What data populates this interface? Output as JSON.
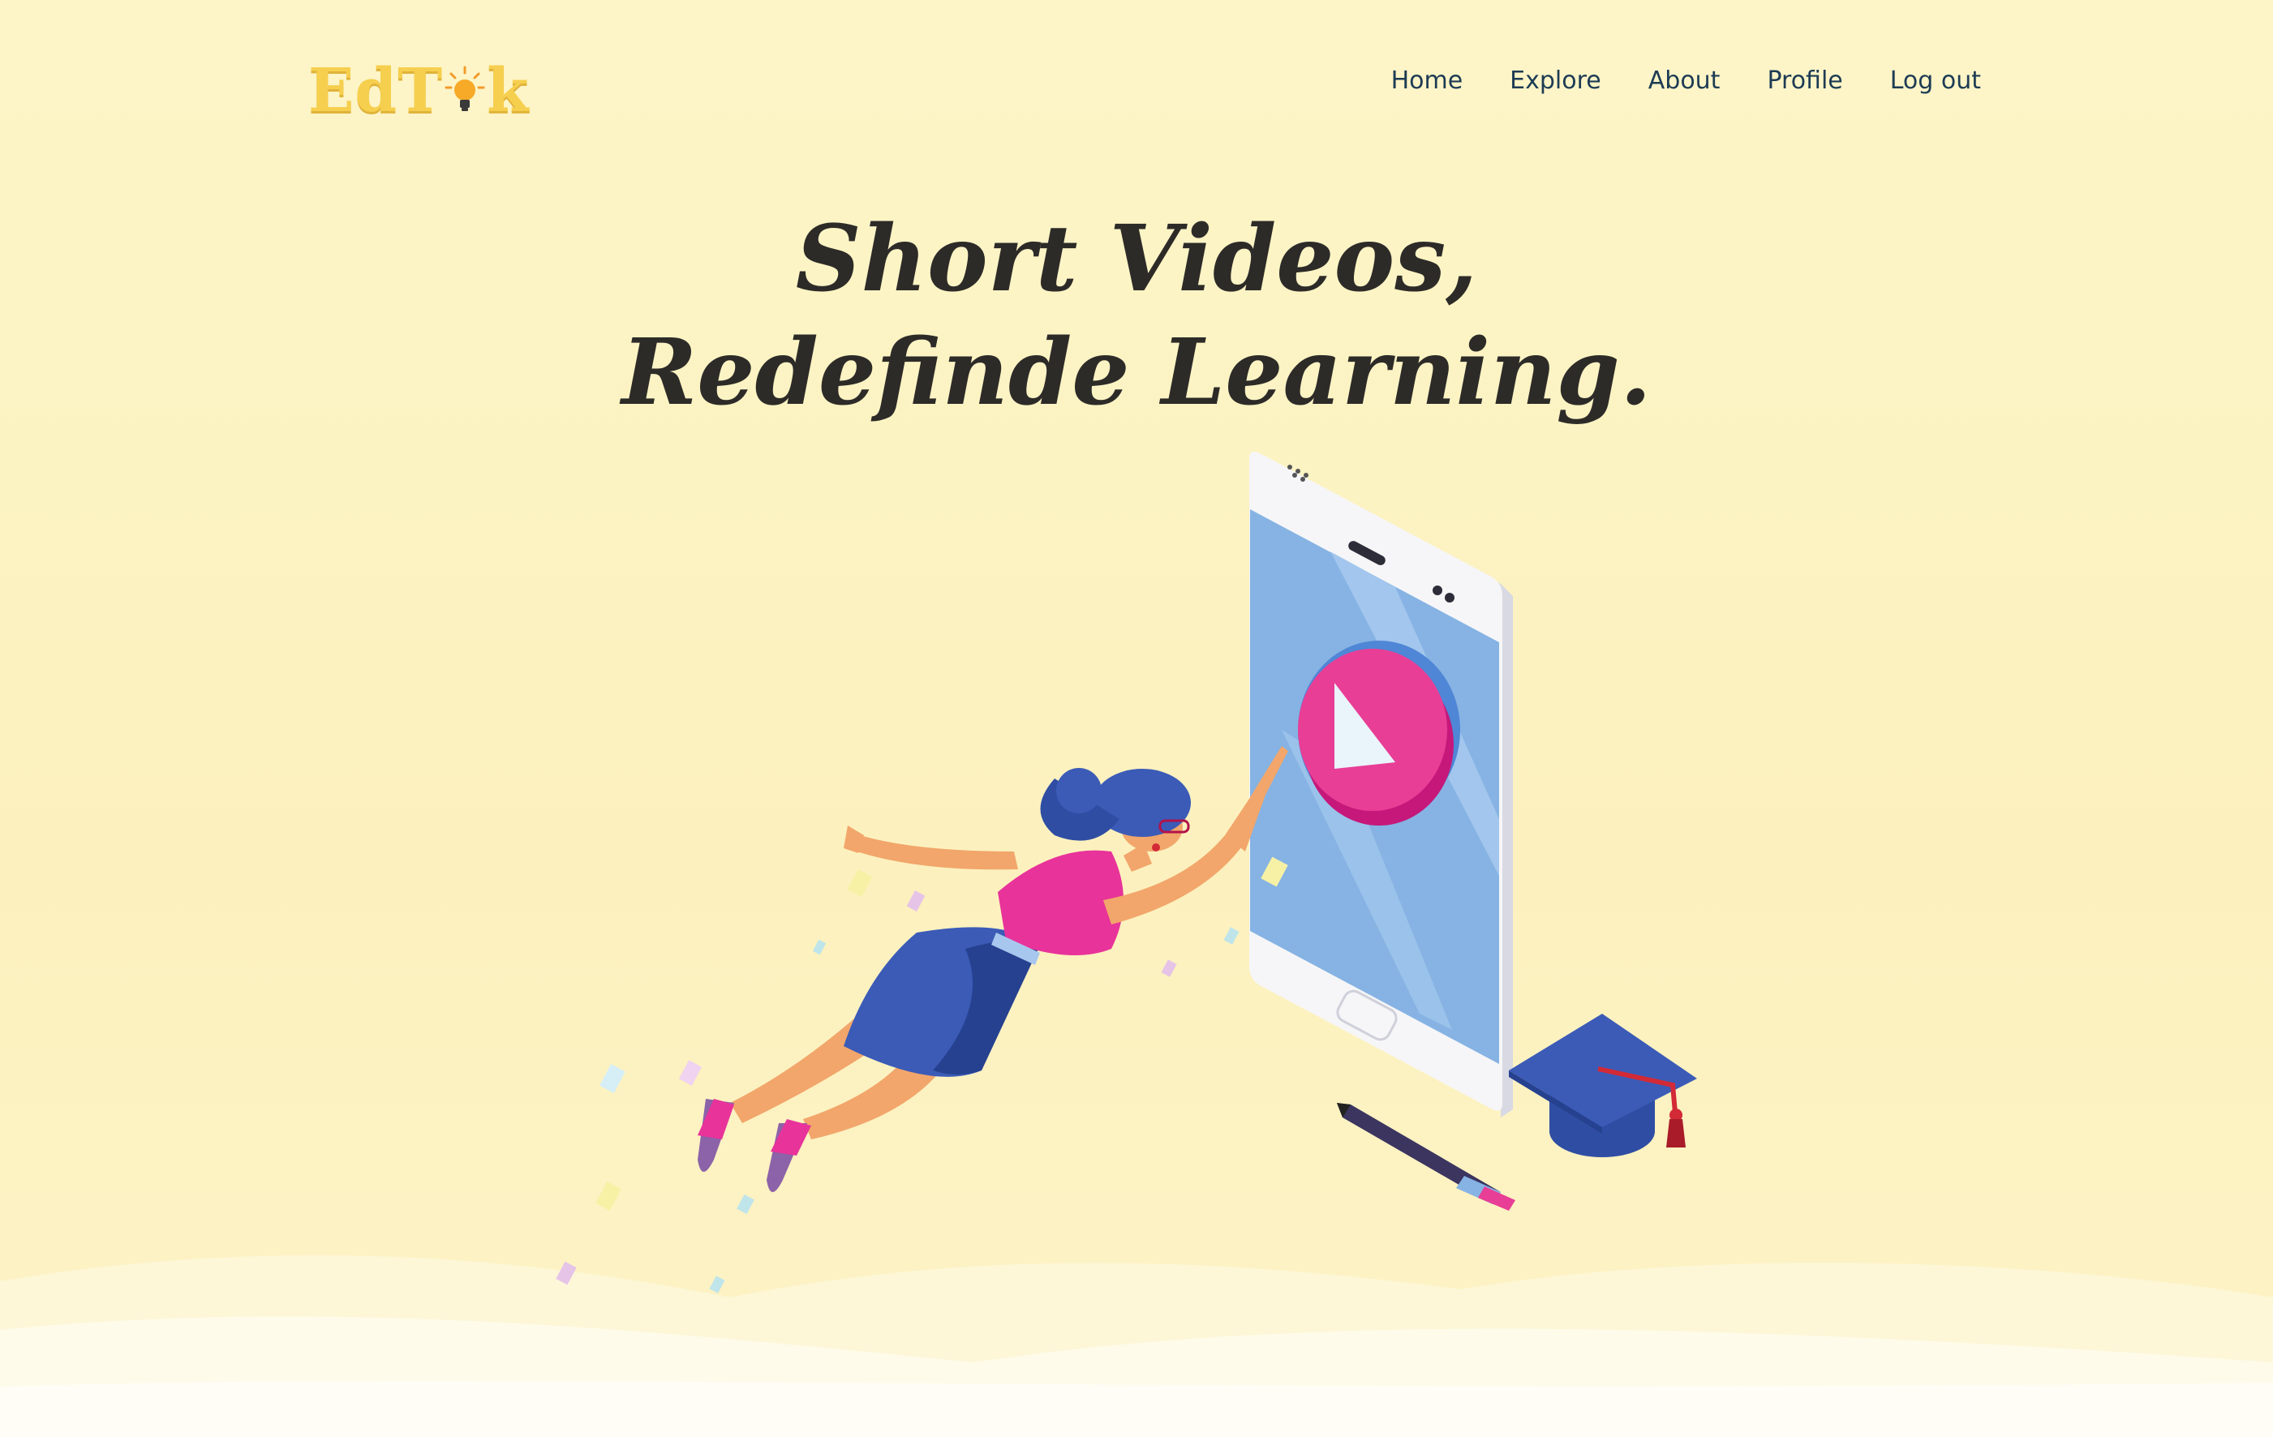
{
  "header": {
    "logo_prefix": "EdT",
    "logo_suffix": "k",
    "nav": [
      {
        "label": "Home"
      },
      {
        "label": "Explore"
      },
      {
        "label": "About"
      },
      {
        "label": "Profile"
      },
      {
        "label": "Log out"
      }
    ]
  },
  "hero": {
    "line1": "Short Videos,",
    "line2": "Redefinde Learning."
  },
  "colors": {
    "background": "#fdf4c6",
    "logo": "#f6cf4e",
    "nav_text": "#1d3b54",
    "title_text": "#2d2b28",
    "phone_screen": "#86b3e3",
    "play_button": "#e83e96"
  },
  "icons": {
    "logo_bulb": "lightbulb-icon",
    "play": "play-button-icon",
    "cap": "graduation-cap-icon",
    "pencil": "pencil-icon"
  }
}
